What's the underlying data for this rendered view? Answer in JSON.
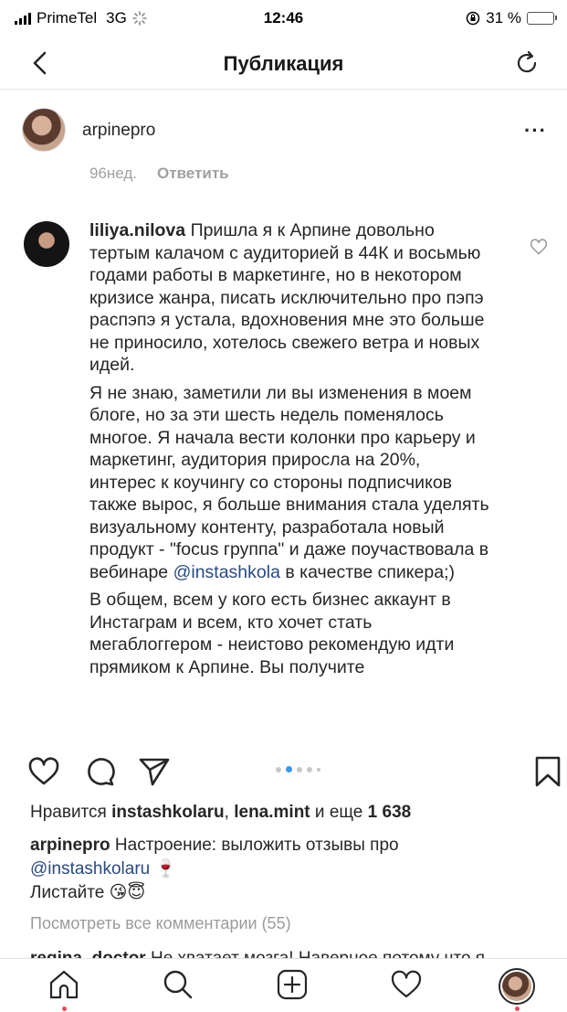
{
  "status_bar": {
    "carrier": "PrimeTel",
    "network": "3G",
    "time": "12:46",
    "battery": "31 %",
    "battery_level": 0.31
  },
  "nav": {
    "title": "Публикация",
    "back_icon": "chevron-left-icon",
    "refresh_icon": "refresh-icon"
  },
  "post": {
    "username": "arpinepro",
    "more_icon": "more-horizontal-icon"
  },
  "media": {
    "prev_time": "96нед.",
    "prev_reply": "Ответить",
    "comment_user": "liliya.nilova",
    "p1": "Пришла я к Арпине довольно тертым калачом с аудиторией в 44К и восьмью годами работы в маркетинге, но в некотором кризисе жанра, писать исключительно про пэпэ распэпэ я устала, вдохновения мне это больше не приносило, хотелось свежего ветра и новых идей.",
    "p2a": "Я не знаю, заметили ли вы изменения в моем блоге, но за эти шесть недель поменялось многое. Я начала вести колонки про карьеру и маркетинг, аудитория приросла на 20%, интерес к коучингу со стороны подписчиков также вырос, я больше внимания стала уделять визуальному контенту, разработала новый продукт - \"focus группа\" и даже поучаствовала в вебинаре",
    "p2_mention": "@instashkola",
    "p2b": "в качестве спикера;)",
    "p3": "В общем, всем у кого есть бизнес аккаунт в Инстаграм и всем, кто хочет стать мегаблоггером - неистово рекомендую идти прямиком к Арпине. Вы получите"
  },
  "actions": {
    "like_icon": "heart-icon",
    "comment_icon": "comment-icon",
    "share_icon": "paper-plane-icon",
    "save_icon": "bookmark-icon",
    "carousel_pages": 5,
    "carousel_active": 2
  },
  "likes": {
    "prefix": "Нравится",
    "user1": "instashkolaru",
    "sep": ",",
    "user2": "lena.mint",
    "and": "и еще",
    "count": "1 638"
  },
  "caption": {
    "username": "arpinepro",
    "text": "Настроение: выложить отзывы про",
    "mention": "@instashkolaru",
    "emoji1": "🍷",
    "line2": "Листайте",
    "emoji2": "😘😇"
  },
  "comments": {
    "view_all": "Посмотреть все комментарии (55)",
    "partial_user": "regina_doctor",
    "partial_text": "Не хватает мозга! Наверное потому что я"
  },
  "tabs": {
    "home_icon": "home-icon",
    "search_icon": "search-icon",
    "add_icon": "plus-square-icon",
    "activity_icon": "heart-icon",
    "profile_icon": "profile-avatar"
  },
  "colors": {
    "accent_blue": "#3897f0",
    "mention": "#2a4a83",
    "notification_red": "#ed4956",
    "muted": "#9b9b9b"
  }
}
